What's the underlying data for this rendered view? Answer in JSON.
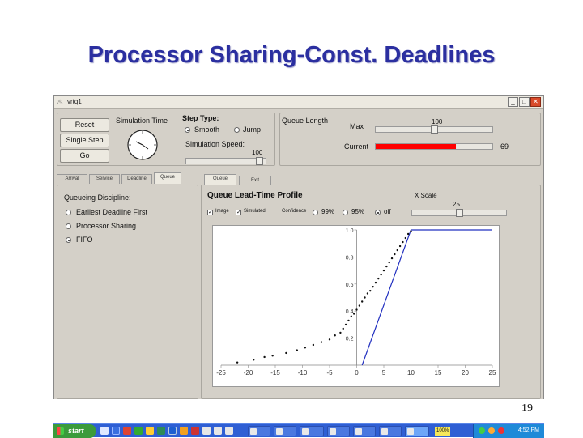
{
  "slide": {
    "title": "Processor Sharing-Const. Deadlines",
    "page_number": "19"
  },
  "window": {
    "title": "vrtq1"
  },
  "controls": {
    "reset_label": "Reset",
    "single_step_label": "Single Step",
    "go_label": "Go",
    "simulation_time_label": "Simulation Time"
  },
  "step_type": {
    "label": "Step Type:",
    "options": [
      "Smooth",
      "Jump"
    ],
    "selected": "Smooth"
  },
  "simulation_speed": {
    "label": "Simulation Speed:",
    "value": "100",
    "fraction": 0.97
  },
  "queue_length": {
    "label": "Queue Length",
    "max_label": "Max",
    "max_value": "100",
    "max_fraction": 0.5,
    "current_label": "Current",
    "current_value": "69",
    "current_fraction": 0.69,
    "bar_color": "#ff0000"
  },
  "left_tabs": [
    "Arrival",
    "Service",
    "Deadline",
    "Queue"
  ],
  "left_tabs_active": "Queue",
  "discipline": {
    "label": "Queueing Discipline:",
    "options": [
      "Earliest Deadline First",
      "Processor Sharing",
      "FIFO"
    ],
    "selected": "FIFO"
  },
  "right_tabs": [
    "Queue",
    "Exit"
  ],
  "right_tabs_active": "Queue",
  "profile": {
    "title": "Queue Lead-Time Profile",
    "scale_label": "X Scale",
    "scale_value": "25",
    "scale_fraction": 0.5,
    "checks": [
      {
        "label": "Image",
        "checked": true
      },
      {
        "label": "Simulated",
        "checked": true
      }
    ],
    "confidence_label": "Confidence",
    "confidence_options": [
      "99%",
      "95%",
      "off"
    ],
    "confidence_selected": "off"
  },
  "colors": {
    "title": "#2b2fa0",
    "theory_line": "#2230c0",
    "sim_points": "#111111",
    "taskbar": "#2f5fd4"
  },
  "chart_data": {
    "type": "scatter",
    "xlim": [
      -25,
      25
    ],
    "ylim": [
      0,
      1.0
    ],
    "xticks": [
      "-25",
      "-20",
      "-15",
      "-10",
      "-5",
      "0",
      "5",
      "10",
      "15",
      "20",
      "25"
    ],
    "yticks": [
      "0.2",
      "0.4",
      "0.6",
      "0.8",
      "1.0"
    ],
    "series": [
      {
        "kind": "line",
        "x": [
          1,
          10,
          25
        ],
        "y": [
          0,
          1.0,
          1.0
        ]
      },
      {
        "kind": "points",
        "x": [
          -22,
          -19,
          -17,
          -15.5,
          -13,
          -11,
          -9.5,
          -8,
          -6.5,
          -5,
          -4,
          -3,
          -2.5,
          -2,
          -1.5,
          -1,
          -0.5,
          0,
          0.5,
          1,
          1.5,
          2,
          2.5,
          3,
          3.5,
          4,
          4.5,
          5,
          5.5,
          6,
          6.5,
          7,
          7.5,
          8,
          8.5,
          9,
          9.5,
          10
        ],
        "y": [
          0.02,
          0.04,
          0.06,
          0.07,
          0.09,
          0.11,
          0.13,
          0.15,
          0.17,
          0.19,
          0.22,
          0.24,
          0.27,
          0.3,
          0.33,
          0.36,
          0.38,
          0.41,
          0.44,
          0.47,
          0.5,
          0.53,
          0.55,
          0.58,
          0.61,
          0.64,
          0.67,
          0.7,
          0.73,
          0.76,
          0.79,
          0.82,
          0.85,
          0.88,
          0.91,
          0.94,
          0.97,
          0.99
        ]
      }
    ]
  },
  "taskbar": {
    "start_label": "start",
    "items": [
      "",
      "",
      "",
      "",
      "",
      "",
      "100%"
    ],
    "clock": "4:52 PM"
  }
}
